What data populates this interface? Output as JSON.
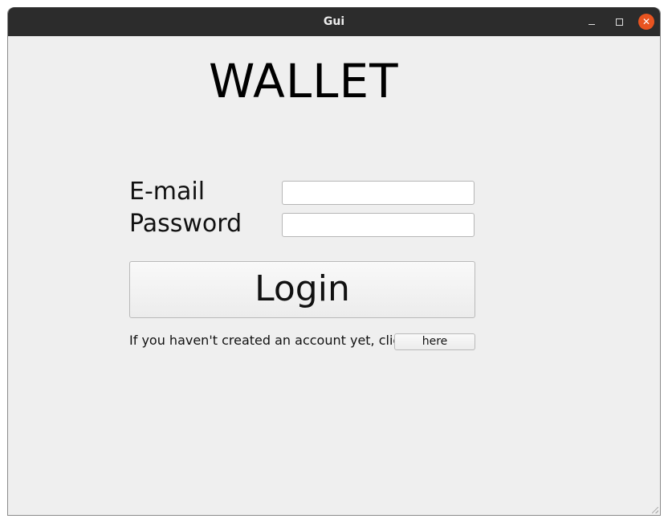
{
  "window": {
    "title": "Gui",
    "minimize_icon": "minimize-icon",
    "maximize_icon": "maximize-icon",
    "close_icon": "close-icon",
    "close_color": "#e95420"
  },
  "main": {
    "heading": "WALLET",
    "email_label": "E-mail",
    "email_value": "",
    "password_label": "Password",
    "password_value": "",
    "login_label": "Login",
    "signup_hint": "If you haven't created an account yet, click",
    "here_label": "here"
  }
}
